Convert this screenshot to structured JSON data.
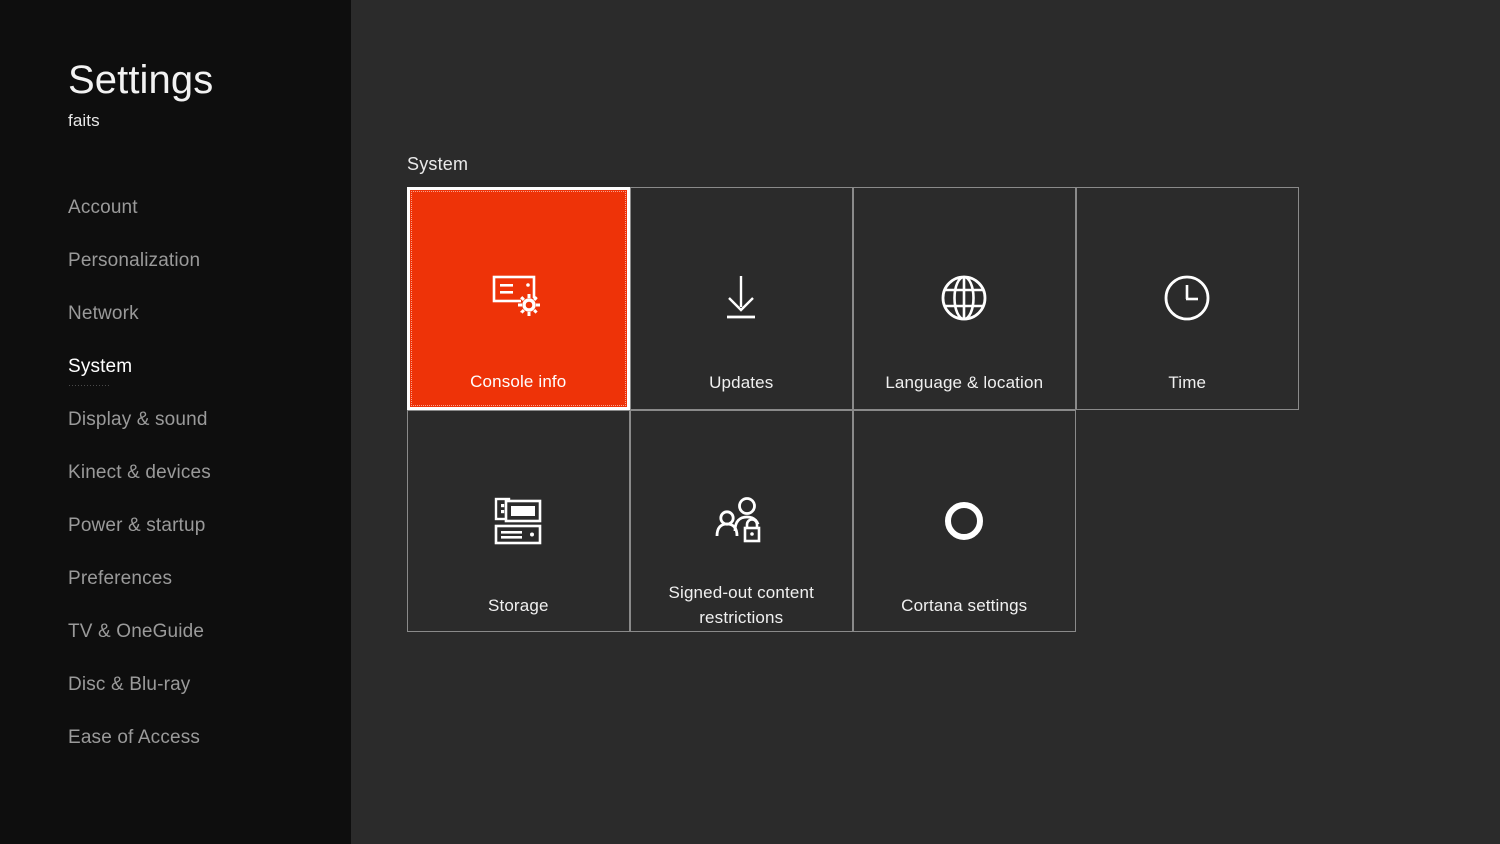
{
  "app": {
    "title": "Settings",
    "subtitle": "faits",
    "background_color": "#2b2b2b",
    "sidebar_color": "#0e0e0e",
    "accent_color": "#ee3308"
  },
  "sidebar": {
    "items": [
      {
        "label": "Account",
        "active": false
      },
      {
        "label": "Personalization",
        "active": false
      },
      {
        "label": "Network",
        "active": false
      },
      {
        "label": "System",
        "active": true
      },
      {
        "label": "Display & sound",
        "active": false
      },
      {
        "label": "Kinect & devices",
        "active": false
      },
      {
        "label": "Power & startup",
        "active": false
      },
      {
        "label": "Preferences",
        "active": false
      },
      {
        "label": "TV & OneGuide",
        "active": false
      },
      {
        "label": "Disc & Blu-ray",
        "active": false
      },
      {
        "label": "Ease of Access",
        "active": false
      }
    ]
  },
  "main": {
    "section_title": "System",
    "tiles": [
      {
        "label": "Console info",
        "icon": "console-gear-icon",
        "focused": true,
        "two_line": false
      },
      {
        "label": "Updates",
        "icon": "download-arrow-icon",
        "focused": false,
        "two_line": false
      },
      {
        "label": "Language & location",
        "icon": "globe-icon",
        "focused": false,
        "two_line": false
      },
      {
        "label": "Time",
        "icon": "clock-icon",
        "focused": false,
        "two_line": false
      },
      {
        "label": "Storage",
        "icon": "storage-drive-icon",
        "focused": false,
        "two_line": false
      },
      {
        "label": "Signed-out content restrictions",
        "icon": "people-lock-icon",
        "focused": false,
        "two_line": true
      },
      {
        "label": "Cortana settings",
        "icon": "cortana-ring-icon",
        "focused": false,
        "two_line": false
      }
    ]
  }
}
